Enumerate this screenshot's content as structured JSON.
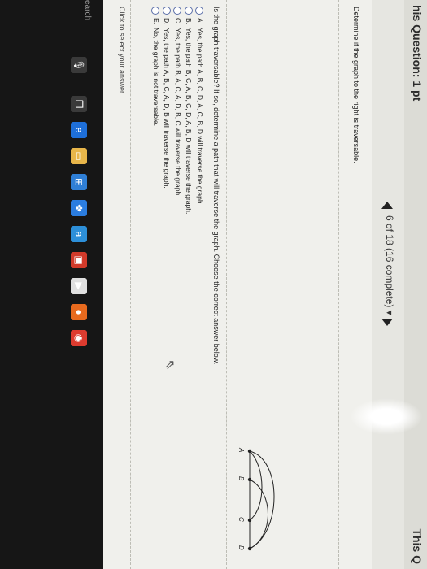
{
  "window": {
    "title": "his Question: 1 pt",
    "title_right": "This Q"
  },
  "navigation": {
    "pager_text": "6 of 18 (16 complete)"
  },
  "prompt": "Determine if the graph to the right is traversable.",
  "question": "Is the graph traversable? If so, determine a path that will traverse the graph. Choose the correct answer below.",
  "options": [
    {
      "letter": "A.",
      "text": "Yes, the path A, B, C, D, A, C, B, D will traverse the graph."
    },
    {
      "letter": "B.",
      "text": "Yes, the path B, C, A, B, C, D, A, B, D will traverse the graph."
    },
    {
      "letter": "C.",
      "text": "Yes, the path B, A, C, A, D, B, C will traverse the graph."
    },
    {
      "letter": "D.",
      "text": "Yes, the path A, B, C, A, D, B will traverse the graph."
    },
    {
      "letter": "E.",
      "text": "No, the graph is not traversable."
    }
  ],
  "hint": "Click to select your answer.",
  "graph": {
    "vertices": [
      "A",
      "B",
      "C",
      "D"
    ]
  },
  "taskbar": {
    "search_label": "earch",
    "icons": [
      {
        "name": "microphone-icon",
        "glyph": "🎙",
        "color": "#3a3a3a"
      },
      {
        "name": "task-view-icon",
        "glyph": "❐",
        "color": "#3a3a3a"
      },
      {
        "name": "edge-icon",
        "glyph": "e",
        "color": "#1e6fd9"
      },
      {
        "name": "file-explorer-icon",
        "glyph": "▭",
        "color": "#e8b64a"
      },
      {
        "name": "store-icon",
        "glyph": "⊞",
        "color": "#2f7fd6"
      },
      {
        "name": "dropbox-icon",
        "glyph": "❖",
        "color": "#2b7de0"
      },
      {
        "name": "amazon-icon",
        "glyph": "a",
        "color": "#2d8fd8"
      },
      {
        "name": "red-app-icon",
        "glyph": "▣",
        "color": "#d23a2a"
      },
      {
        "name": "terminal-icon",
        "glyph": "▶",
        "color": "#e0e0e0"
      },
      {
        "name": "app-icon",
        "glyph": "●",
        "color": "#e86a1e"
      },
      {
        "name": "chrome-icon",
        "glyph": "◉",
        "color": "#dd3b2f"
      }
    ]
  }
}
